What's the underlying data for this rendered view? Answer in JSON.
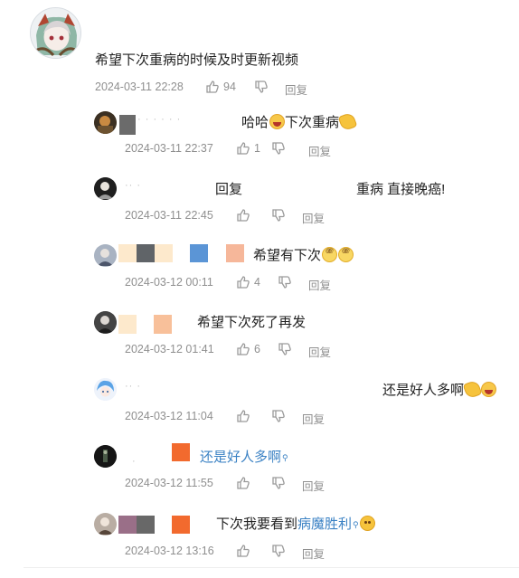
{
  "main_comment": {
    "text": "希望下次重病的时候及时更新视频",
    "timestamp": "2024-03-11 22:28",
    "likes": "94",
    "reply_label": "回复"
  },
  "replies": [
    {
      "prefix": "",
      "text": "哈哈",
      "text2": "下次重病",
      "timestamp": "2024-03-11 22:37",
      "likes": "1",
      "reply_label": "回复"
    },
    {
      "prefix": "回复",
      "text": "重病 直接晚癌!",
      "timestamp": "2024-03-11 22:45",
      "likes": "",
      "reply_label": "回复"
    },
    {
      "text": "希望有下次",
      "timestamp": "2024-03-12 00:11",
      "likes": "4",
      "reply_label": "回复"
    },
    {
      "text": "希望下次死了再发",
      "timestamp": "2024-03-12 01:41",
      "likes": "6",
      "reply_label": "回复"
    },
    {
      "text": "还是好人多啊",
      "timestamp": "2024-03-12 11:04",
      "likes": "",
      "reply_label": "回复"
    },
    {
      "text": "还是好人多啊",
      "timestamp": "2024-03-12 11:55",
      "likes": "",
      "reply_label": "回复"
    },
    {
      "text": "下次我要看到",
      "link": "病魔胜利",
      "timestamp": "2024-03-12 13:16",
      "likes": "",
      "reply_label": "回复"
    }
  ],
  "colors": {
    "meta": "#8f8f8f",
    "link": "#3b82c4",
    "text": "#222222"
  },
  "icons": {
    "like": "thumb-up-icon",
    "dislike": "thumb-down-icon",
    "search": "search-icon"
  }
}
